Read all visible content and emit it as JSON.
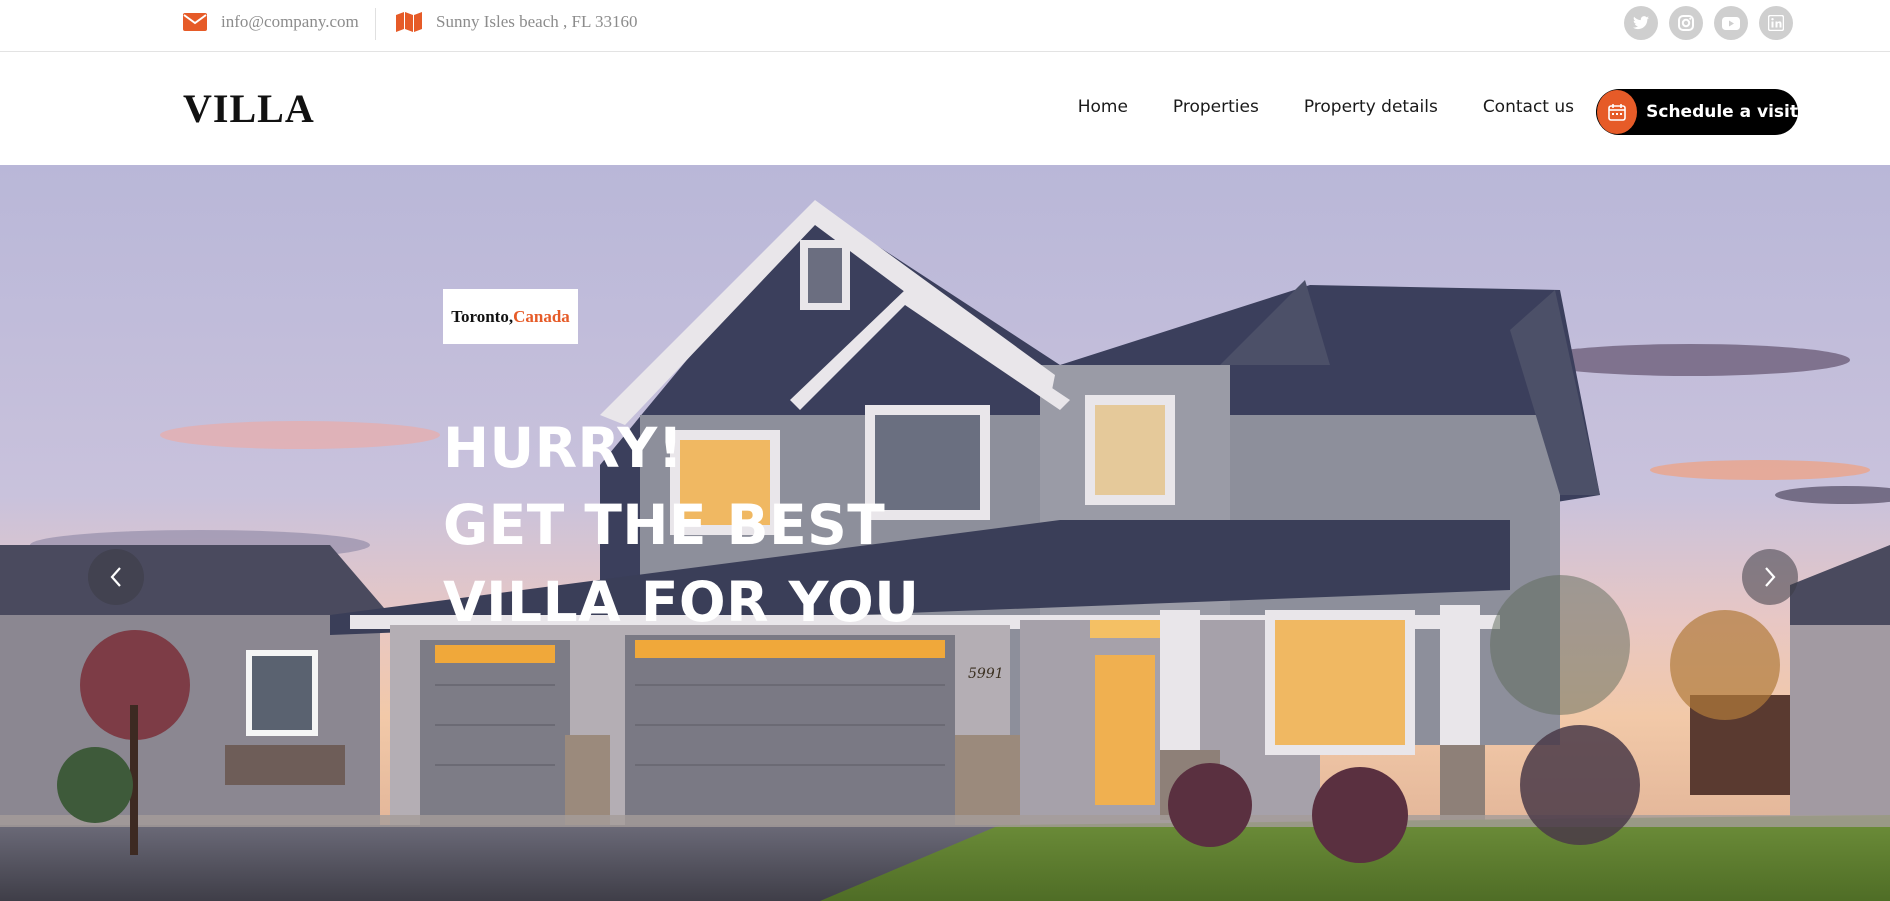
{
  "topbar": {
    "email": "info@company.com",
    "email_icon": "envelope-icon",
    "address": "Sunny Isles beach , FL 33160",
    "address_icon": "map-icon",
    "socials": [
      "twitter-icon",
      "instagram-icon",
      "youtube-icon",
      "linkedin-icon"
    ]
  },
  "header": {
    "logo": "VILLA",
    "nav": [
      "Home",
      "Properties",
      "Property details",
      "Contact us"
    ],
    "cta_label": "Schedule a visit",
    "cta_icon": "calendar-icon"
  },
  "hero": {
    "location_city": "Toronto,",
    "location_country": "Canada",
    "headline": [
      "HURRY!",
      "GET THE BEST",
      "VILLA FOR YOU"
    ],
    "house_number": "5991",
    "prev_icon": "chevron-left-icon",
    "next_icon": "chevron-right-icon"
  },
  "colors": {
    "accent": "#e65b28",
    "cta_bg": "#000000",
    "social_bg": "#cfcfcf",
    "headline_text": "#ffffff"
  }
}
